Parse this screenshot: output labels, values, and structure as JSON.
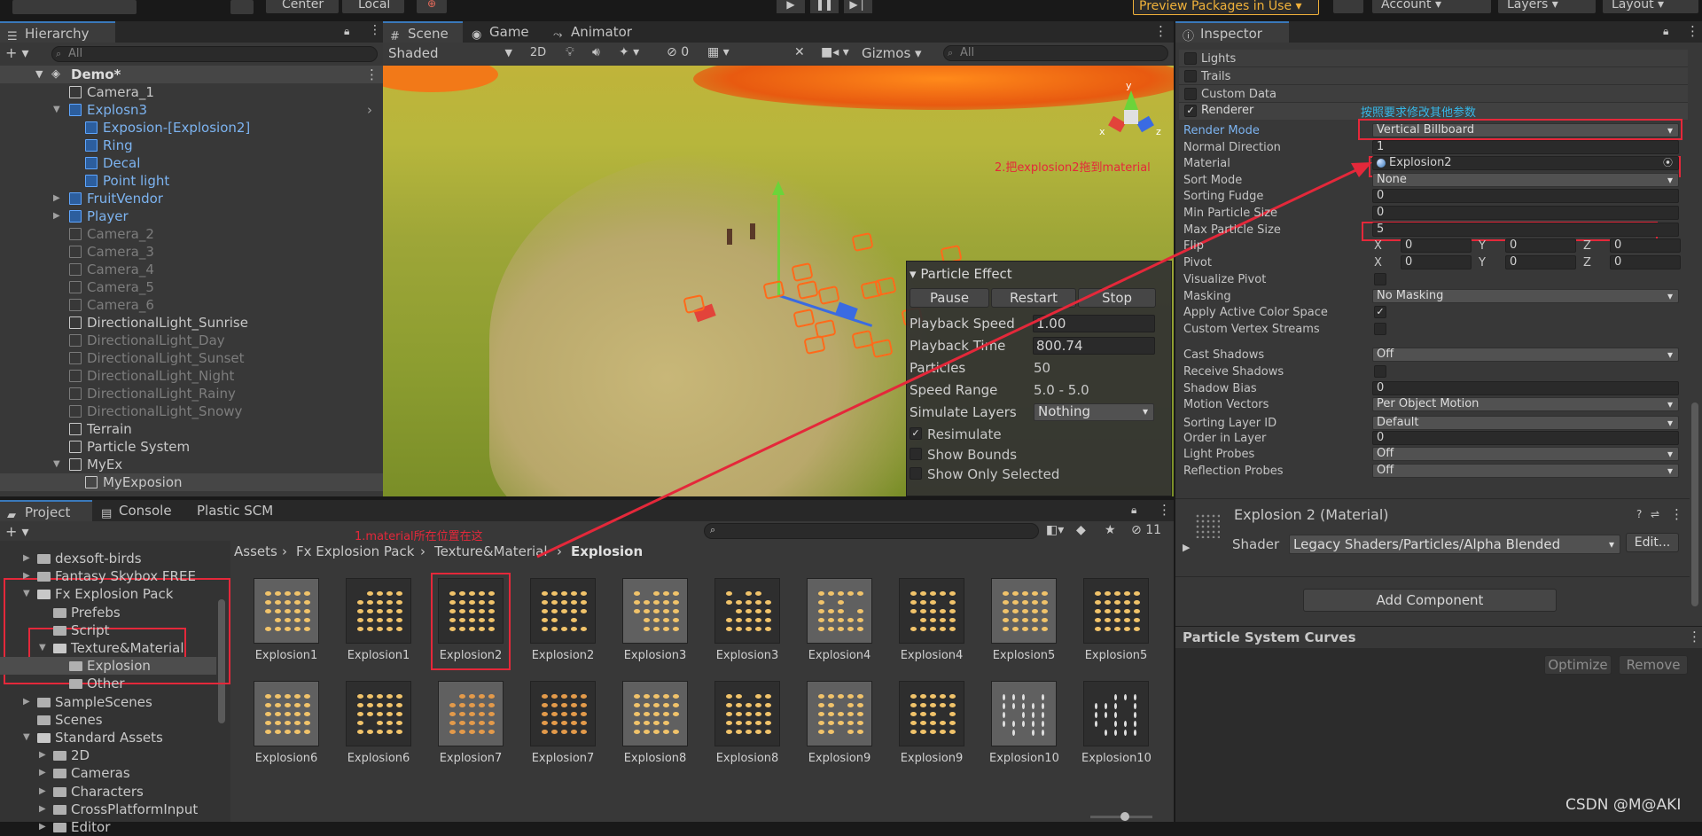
{
  "toolbar": {
    "pivot_label": "Center",
    "space_label": "Local",
    "preview_packages": "Preview Packages in Use ▾",
    "account": "Account",
    "layers": "Layers",
    "layout": "Layout"
  },
  "hierarchy": {
    "tab": "Hierarchy",
    "search_placeholder": "All",
    "scene": "Demo*",
    "items": [
      {
        "label": "Camera_1",
        "style": "normal"
      },
      {
        "label": "Explosn3",
        "style": "blue"
      },
      {
        "label": "Exposion-[Explosion2]",
        "style": "blue"
      },
      {
        "label": "Ring",
        "style": "blue"
      },
      {
        "label": "Decal",
        "style": "blue"
      },
      {
        "label": "Point light",
        "style": "blue"
      },
      {
        "label": "FruitVendor",
        "style": "blue"
      },
      {
        "label": "Player",
        "style": "blue"
      },
      {
        "label": "Camera_2",
        "style": "dim"
      },
      {
        "label": "Camera_3",
        "style": "dim"
      },
      {
        "label": "Camera_4",
        "style": "dim"
      },
      {
        "label": "Camera_5",
        "style": "dim"
      },
      {
        "label": "Camera_6",
        "style": "dim"
      },
      {
        "label": "DirectionalLight_Sunrise",
        "style": "normal"
      },
      {
        "label": "DirectionalLight_Day",
        "style": "dim"
      },
      {
        "label": "DirectionalLight_Sunset",
        "style": "dim"
      },
      {
        "label": "DirectionalLight_Night",
        "style": "dim"
      },
      {
        "label": "DirectionalLight_Rainy",
        "style": "dim"
      },
      {
        "label": "DirectionalLight_Snowy",
        "style": "dim"
      },
      {
        "label": "Terrain",
        "style": "normal"
      },
      {
        "label": "Particle System",
        "style": "normal"
      },
      {
        "label": "MyEx",
        "style": "normal"
      },
      {
        "label": "MyExposion",
        "style": "normal"
      }
    ]
  },
  "scene": {
    "tabs": [
      "Scene",
      "Game",
      "Animator"
    ],
    "shading": "Shaded",
    "mode_2d": "2D",
    "hidden_count": "0",
    "gizmos": "Gizmos",
    "search_placeholder": "All",
    "annotation": "2.把explosion2拖到material"
  },
  "particle_effect": {
    "title": "Particle Effect",
    "buttons": [
      "Pause",
      "Restart",
      "Stop"
    ],
    "playback_speed_label": "Playback Speed",
    "playback_speed": "1.00",
    "playback_time_label": "Playback Time",
    "playback_time": "800.74",
    "particles_label": "Particles",
    "particles": "50",
    "speed_range_label": "Speed Range",
    "speed_range": "5.0 - 5.0",
    "simulate_layers_label": "Simulate Layers",
    "simulate_layers": "Nothing",
    "resimulate": "Resimulate",
    "show_bounds": "Show Bounds",
    "show_only_selected": "Show Only Selected"
  },
  "project": {
    "tabs": [
      "Project",
      "Console",
      "Plastic SCM"
    ],
    "annotation": "1.material所在位置在这",
    "hidden_count": "11",
    "tree": [
      {
        "label": "dexsoft-birds",
        "indent": 1
      },
      {
        "label": "Fantasy Skybox FREE",
        "indent": 1
      },
      {
        "label": "Fx Explosion Pack",
        "indent": 1,
        "open": true
      },
      {
        "label": "Prefebs",
        "indent": 2
      },
      {
        "label": "Script",
        "indent": 2
      },
      {
        "label": "Texture&Material",
        "indent": 2,
        "open": true
      },
      {
        "label": "Explosion",
        "indent": 3,
        "selected": true
      },
      {
        "label": "Other",
        "indent": 3
      },
      {
        "label": "SampleScenes",
        "indent": 1
      },
      {
        "label": "Scenes",
        "indent": 1
      },
      {
        "label": "Standard Assets",
        "indent": 1,
        "open": true
      },
      {
        "label": "2D",
        "indent": 2
      },
      {
        "label": "Cameras",
        "indent": 2
      },
      {
        "label": "Characters",
        "indent": 2
      },
      {
        "label": "CrossPlatformInput",
        "indent": 2
      },
      {
        "label": "Editor",
        "indent": 2
      }
    ],
    "breadcrumb": [
      "Assets",
      "Fx Explosion Pack",
      "Texture&Material",
      "Explosion"
    ],
    "assets": [
      "Explosion1",
      "Explosion1",
      "Explosion2",
      "Explosion2",
      "Explosion3",
      "Explosion3",
      "Explosion4",
      "Explosion4",
      "Explosion5",
      "Explosion5",
      "Explosion6",
      "Explosion6",
      "Explosion7",
      "Explosion7",
      "Explosion8",
      "Explosion8",
      "Explosion9",
      "Explosion9",
      "Explosion10",
      "Explosion10"
    ]
  },
  "inspector": {
    "tab": "Inspector",
    "modules": [
      "Lights",
      "Trails",
      "Custom Data"
    ],
    "renderer_label": "Renderer",
    "annotation": "按照要求修改其他参数",
    "props": [
      {
        "label": "Render Mode",
        "value": "Vertical Billboard",
        "kind": "drop"
      },
      {
        "label": "Normal Direction",
        "value": "1",
        "kind": "field"
      },
      {
        "label": "Material",
        "value": "Explosion2",
        "kind": "obj"
      },
      {
        "label": "Sort Mode",
        "value": "None",
        "kind": "drop"
      },
      {
        "label": "Sorting Fudge",
        "value": "0",
        "kind": "field"
      },
      {
        "label": "Min Particle Size",
        "value": "0",
        "kind": "field"
      },
      {
        "label": "Max Particle Size",
        "value": "5",
        "kind": "field"
      },
      {
        "label": "Flip",
        "value": "",
        "kind": "xyz"
      },
      {
        "label": "Pivot",
        "value": "",
        "kind": "xyz"
      },
      {
        "label": "Visualize Pivot",
        "value": "",
        "kind": "check"
      },
      {
        "label": "Masking",
        "value": "No Masking",
        "kind": "drop"
      },
      {
        "label": "Apply Active Color Space",
        "value": "✓",
        "kind": "check"
      },
      {
        "label": "Custom Vertex Streams",
        "value": "",
        "kind": "check"
      },
      {
        "label": "Cast Shadows",
        "value": "Off",
        "kind": "drop"
      },
      {
        "label": "Receive Shadows",
        "value": "",
        "kind": "check"
      },
      {
        "label": "Shadow Bias",
        "value": "0",
        "kind": "field"
      },
      {
        "label": "Motion Vectors",
        "value": "Per Object Motion",
        "kind": "drop"
      },
      {
        "label": "Sorting Layer ID",
        "value": "Default",
        "kind": "drop"
      },
      {
        "label": "Order in Layer",
        "value": "0",
        "kind": "field"
      },
      {
        "label": "Light Probes",
        "value": "Off",
        "kind": "drop"
      },
      {
        "label": "Reflection Probes",
        "value": "Off",
        "kind": "drop"
      }
    ],
    "xyz": {
      "x": "X",
      "y": "Y",
      "z": "Z",
      "zero": "0"
    },
    "material_title": "Explosion 2 (Material)",
    "shader_label": "Shader",
    "shader_value": "Legacy Shaders/Particles/Alpha Blended",
    "edit_label": "Edit...",
    "add_component": "Add Component",
    "curves_title": "Particle System Curves",
    "optimize": "Optimize",
    "remove": "Remove"
  },
  "watermark": "CSDN @M@AKI",
  "colors": {
    "accent": "#3a79bb",
    "highlight": "#e4283a",
    "annotation_blue": "#36b6e6",
    "preview_gold": "#f0b13a"
  }
}
